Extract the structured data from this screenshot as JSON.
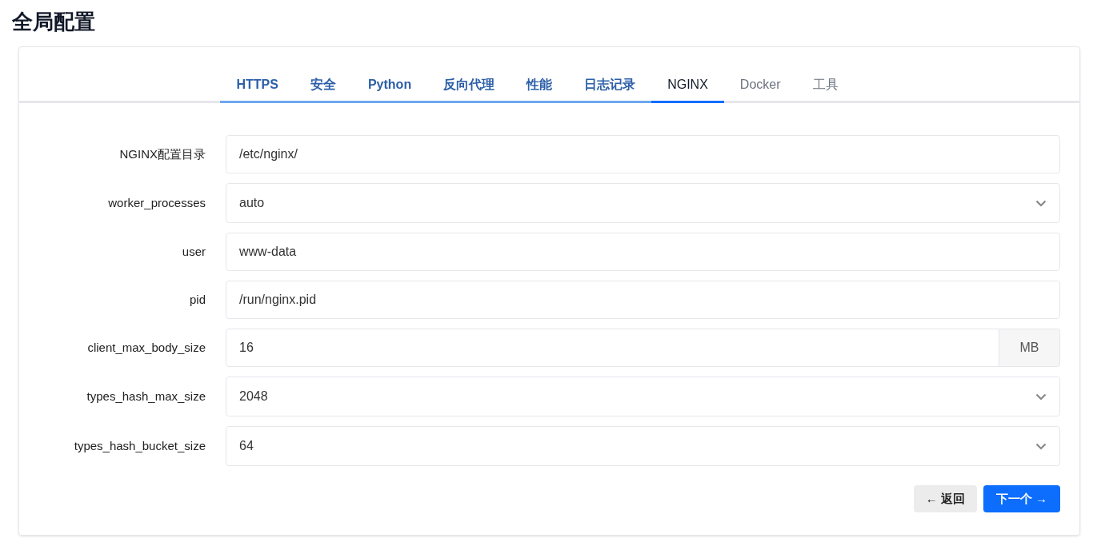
{
  "title": "全局配置",
  "tabs": [
    {
      "label": "HTTPS",
      "completed": true,
      "selected": false
    },
    {
      "label": "安全",
      "completed": true,
      "selected": false
    },
    {
      "label": "Python",
      "completed": true,
      "selected": false
    },
    {
      "label": "反向代理",
      "completed": true,
      "selected": false
    },
    {
      "label": "性能",
      "completed": true,
      "selected": false
    },
    {
      "label": "日志记录",
      "completed": true,
      "selected": false
    },
    {
      "label": "NGINX",
      "completed": false,
      "selected": true
    },
    {
      "label": "Docker",
      "completed": false,
      "selected": false
    },
    {
      "label": "工具",
      "completed": false,
      "selected": false
    }
  ],
  "fields": [
    {
      "kind": "text",
      "label": "NGINX配置目录",
      "value": "/etc/nginx/"
    },
    {
      "kind": "select",
      "label": "worker_processes",
      "value": "auto"
    },
    {
      "kind": "text",
      "label": "user",
      "value": "www-data"
    },
    {
      "kind": "text",
      "label": "pid",
      "value": "/run/nginx.pid"
    },
    {
      "kind": "addon",
      "label": "client_max_body_size",
      "value": "16",
      "addon": "MB"
    },
    {
      "kind": "select",
      "label": "types_hash_max_size",
      "value": "2048"
    },
    {
      "kind": "select",
      "label": "types_hash_bucket_size",
      "value": "64"
    }
  ],
  "buttons": {
    "back": "← 返回",
    "next": "下一个 →"
  }
}
